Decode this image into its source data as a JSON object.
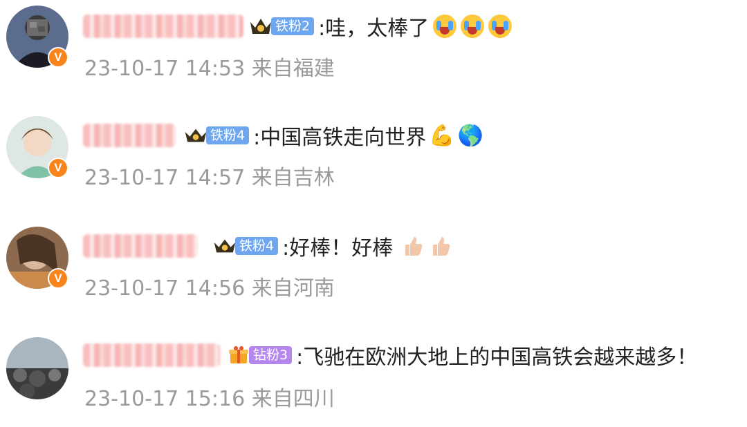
{
  "comments": [
    {
      "badge_level": "铁粉2",
      "badge_color": "#6ea6f0",
      "crown_icon": "crown-star-icon",
      "text": ":哇，太棒了",
      "emojis": [
        "crying-face-icon",
        "crying-face-icon",
        "crying-face-icon"
      ],
      "time": "23-10-17 14:53",
      "location": "来自福建",
      "verified": "V"
    },
    {
      "badge_level": "铁粉4",
      "badge_color": "#6ea6f0",
      "crown_icon": "crown-star-icon",
      "text": ":中国高铁走向世界",
      "emojis": [
        "flexed-biceps-icon",
        "globe-icon"
      ],
      "time": "23-10-17 14:57",
      "location": "来自吉林",
      "verified": "V"
    },
    {
      "badge_level": "铁粉4",
      "badge_color": "#6ea6f0",
      "crown_icon": "crown-star-icon",
      "text": ":好棒！好棒",
      "emojis": [
        "thumbs-up-icon",
        "thumbs-up-icon"
      ],
      "time": "23-10-17 14:56",
      "location": "来自河南",
      "verified": "V"
    },
    {
      "badge_level": "钻粉3",
      "badge_color": "#b486ee",
      "crown_icon": "gift-icon",
      "text": ":飞驰在欧洲大地上的中国高铁会越来越多！",
      "emojis": [],
      "time": "23-10-17 15:16",
      "location": "来自四川",
      "verified": ""
    }
  ]
}
